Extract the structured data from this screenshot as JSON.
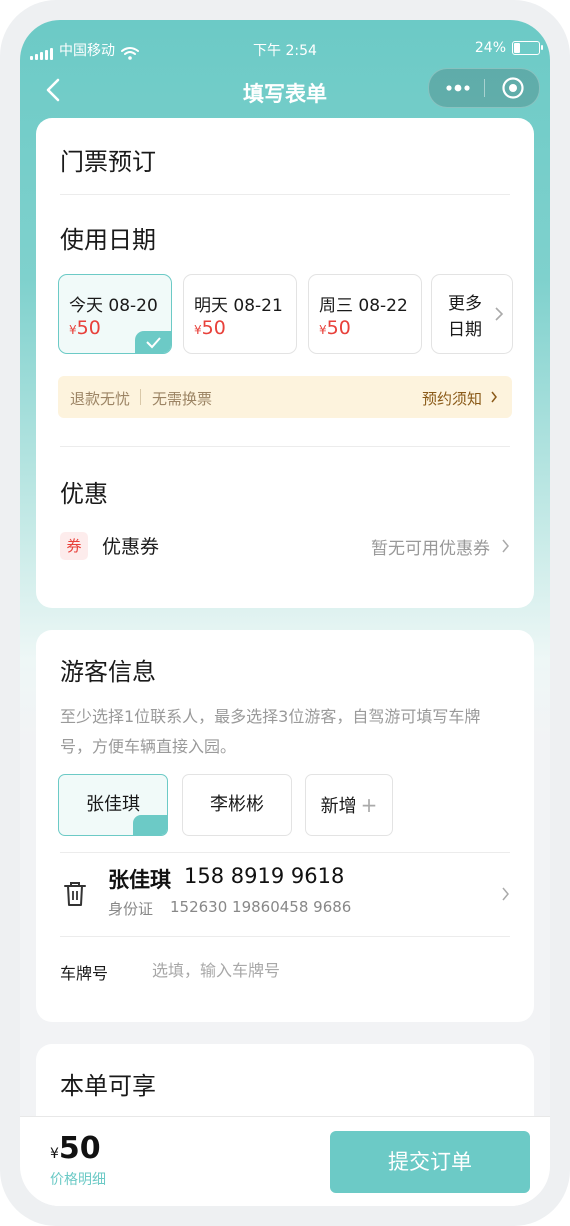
{
  "status_bar": {
    "carrier": "中国移动",
    "time": "下午 2:54",
    "battery": "24%"
  },
  "nav": {
    "title": "填写表单"
  },
  "ticket": {
    "section_title": "门票预订",
    "date_title": "使用日期",
    "dates": [
      {
        "label": "今天  08-20",
        "currency": "¥",
        "price": "50",
        "selected": true
      },
      {
        "label": "明天  08-21",
        "currency": "¥",
        "price": "50",
        "selected": false
      },
      {
        "label": "周三  08-22",
        "currency": "¥",
        "price": "50",
        "selected": false
      }
    ],
    "more_dates": "更多\n日期",
    "notice": {
      "refund": "退款无忧",
      "no_exchange": "无需换票",
      "booking_notes": "预约须知"
    }
  },
  "discount": {
    "title": "优惠",
    "coupon_tag": "券",
    "coupon_label": "优惠券",
    "coupon_status": "暂无可用优惠券"
  },
  "visitors": {
    "title": "游客信息",
    "hint": "至少选择1位联系人，最多选择3位游客，自驾游可填写车牌号，方便车辆直接入园。",
    "options": [
      {
        "label": "张佳琪",
        "selected": true
      },
      {
        "label": "李彬彬",
        "selected": false
      }
    ],
    "add_label": "新增",
    "add_symbol": "+",
    "selected": {
      "name": "张佳琪",
      "phone": "158 8919 9618",
      "id_type": "身份证",
      "id_number": "152630 19860458 9686"
    },
    "plate": {
      "label": "车牌号",
      "placeholder": "选填，输入车牌号"
    }
  },
  "benefits": {
    "title": "本单可享"
  },
  "footer": {
    "currency": "¥",
    "total": "50",
    "price_detail": "价格明细",
    "submit": "提交订单"
  },
  "colors": {
    "accent": "#6ccac6",
    "price_red": "#e8413b",
    "notice_bg": "#fdf3dd"
  }
}
